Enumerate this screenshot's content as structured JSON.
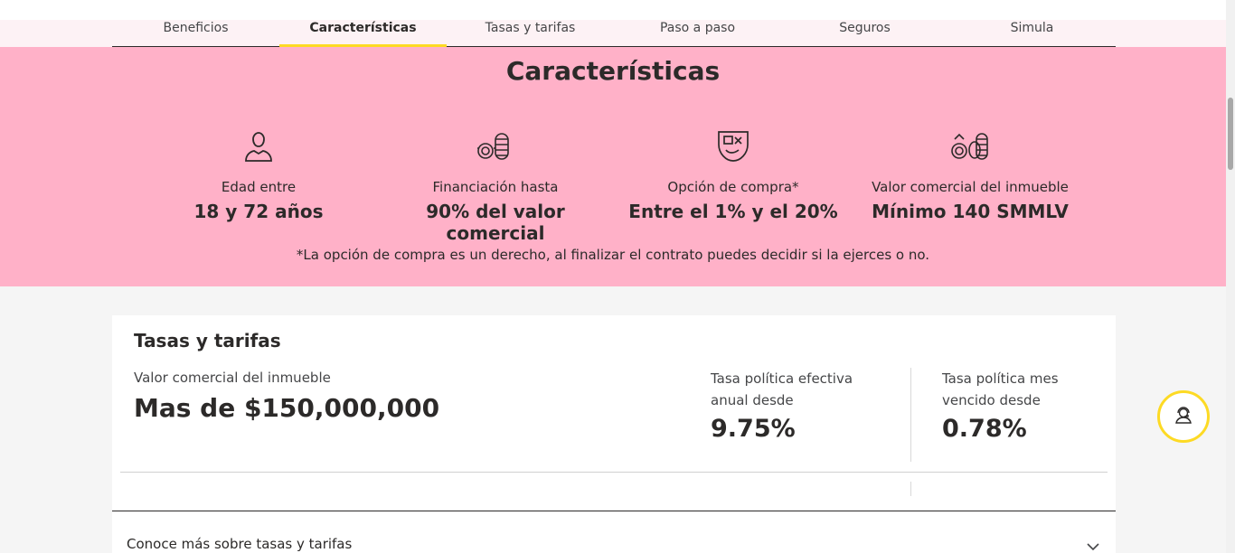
{
  "nav": {
    "tabs": [
      {
        "label": "Beneficios"
      },
      {
        "label": "Características"
      },
      {
        "label": "Tasas y tarifas"
      },
      {
        "label": "Paso a paso"
      },
      {
        "label": "Seguros"
      },
      {
        "label": "Simula"
      }
    ],
    "active_tab": "Características"
  },
  "caracteristicas": {
    "title": "Características",
    "features": [
      {
        "icon": "person-icon",
        "label": "Edad entre",
        "value": "18 y 72 años"
      },
      {
        "icon": "coins-icon",
        "label": "Financiación hasta",
        "value": "90% del valor comercial"
      },
      {
        "icon": "purchase-option-icon",
        "label": "Opción de compra*",
        "value": "Entre el 1% y el 20%"
      },
      {
        "icon": "coins-up-icon",
        "label": "Valor comercial del inmueble",
        "value": "Mínimo 140 SMMLV"
      }
    ],
    "note": "*La opción de compra es un derecho, al finalizar el contrato puedes decidir si la ejerces o no."
  },
  "tasas": {
    "title": "Tasas y tarifas",
    "valor_label": "Valor comercial del inmueble",
    "valor_value": "Mas de $150,000,000",
    "rate1_label": "Tasa política efectiva anual desde",
    "rate1_value": "9.75%",
    "rate2_label": "Tasa política mes vencido desde",
    "rate2_value": "0.78%",
    "more_label": "Conoce más sobre tasas y tarifas"
  },
  "colors": {
    "pink_band": "#ffb1c8",
    "accent_yellow": "#fdda24",
    "text_dark": "#2c2a29"
  },
  "floating_button_icon": "support-agent-icon"
}
